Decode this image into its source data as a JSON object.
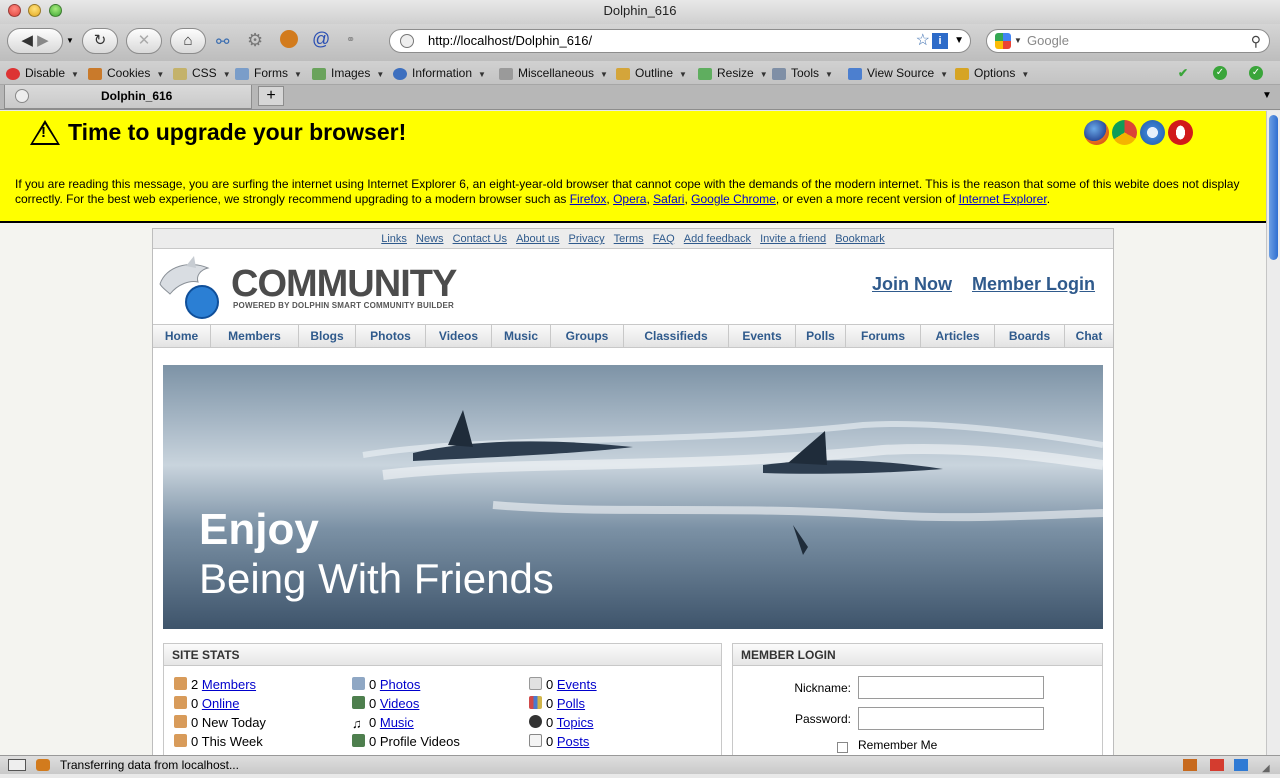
{
  "window": {
    "title": "Dolphin_616"
  },
  "navbar": {
    "url": "http://localhost/Dolphin_616/",
    "search_placeholder": "Google"
  },
  "devbar": {
    "items": [
      "Disable",
      "Cookies",
      "CSS",
      "Forms",
      "Images",
      "Information",
      "Miscellaneous",
      "Outline",
      "Resize",
      "Tools",
      "View Source",
      "Options"
    ]
  },
  "tab": {
    "label": "Dolphin_616",
    "new_tab": "+"
  },
  "upgrade": {
    "heading": "Time to upgrade your browser!",
    "text_before": "If you are reading this message, you are surfing the internet using Internet Explorer 6, an eight-year-old browser that cannot cope with the demands of the modern internet. This is the reason that some of this webite does not display correctly. For the best web experience, we strongly recommend upgrading to a modern browser such as ",
    "links": [
      "Firefox",
      "Opera",
      "Safari",
      "Google Chrome",
      "Internet Explorer"
    ],
    "sep1": ", ",
    "sep2": ", ",
    "sep3": ", ",
    "text_middle": ", or even a more recent version of ",
    "text_end": "."
  },
  "site": {
    "top_links": [
      "Links",
      "News",
      "Contact Us",
      "About us",
      "Privacy",
      "Terms",
      "FAQ",
      "Add feedback",
      "Invite a friend",
      "Bookmark"
    ],
    "brand": "COMMUNITY",
    "brand_sub": "POWERED BY DOLPHIN SMART COMMUNITY BUILDER",
    "join_now": "Join Now",
    "member_login_link": "Member Login",
    "menu": [
      "Home",
      "Members",
      "Blogs",
      "Photos",
      "Videos",
      "Music",
      "Groups",
      "Classifieds",
      "Events",
      "Polls",
      "Forums",
      "Articles",
      "Boards",
      "Chat"
    ],
    "hero": {
      "line1": "Enjoy",
      "line2": "Being With Friends"
    }
  },
  "stats": {
    "title": "SITE STATS",
    "col1": [
      {
        "count": "2",
        "label": "Members",
        "link": true
      },
      {
        "count": "0",
        "label": "Online",
        "link": true
      },
      {
        "count": "0",
        "label": "New Today",
        "link": false
      },
      {
        "count": "0",
        "label": "This Week",
        "link": false
      }
    ],
    "col2": [
      {
        "count": "0",
        "label": "Photos",
        "link": true
      },
      {
        "count": "0",
        "label": "Videos",
        "link": true
      },
      {
        "count": "0",
        "label": "Music",
        "link": true
      },
      {
        "count": "0",
        "label": "Profile Videos",
        "link": false
      }
    ],
    "col3": [
      {
        "count": "0",
        "label": "Events",
        "link": true
      },
      {
        "count": "0",
        "label": "Polls",
        "link": true
      },
      {
        "count": "0",
        "label": "Topics",
        "link": true
      },
      {
        "count": "0",
        "label": "Posts",
        "link": true
      }
    ]
  },
  "login": {
    "title": "MEMBER LOGIN",
    "nickname_label": "Nickname:",
    "password_label": "Password:",
    "remember": "Remember Me"
  },
  "status": {
    "text": "Transferring data from localhost..."
  }
}
